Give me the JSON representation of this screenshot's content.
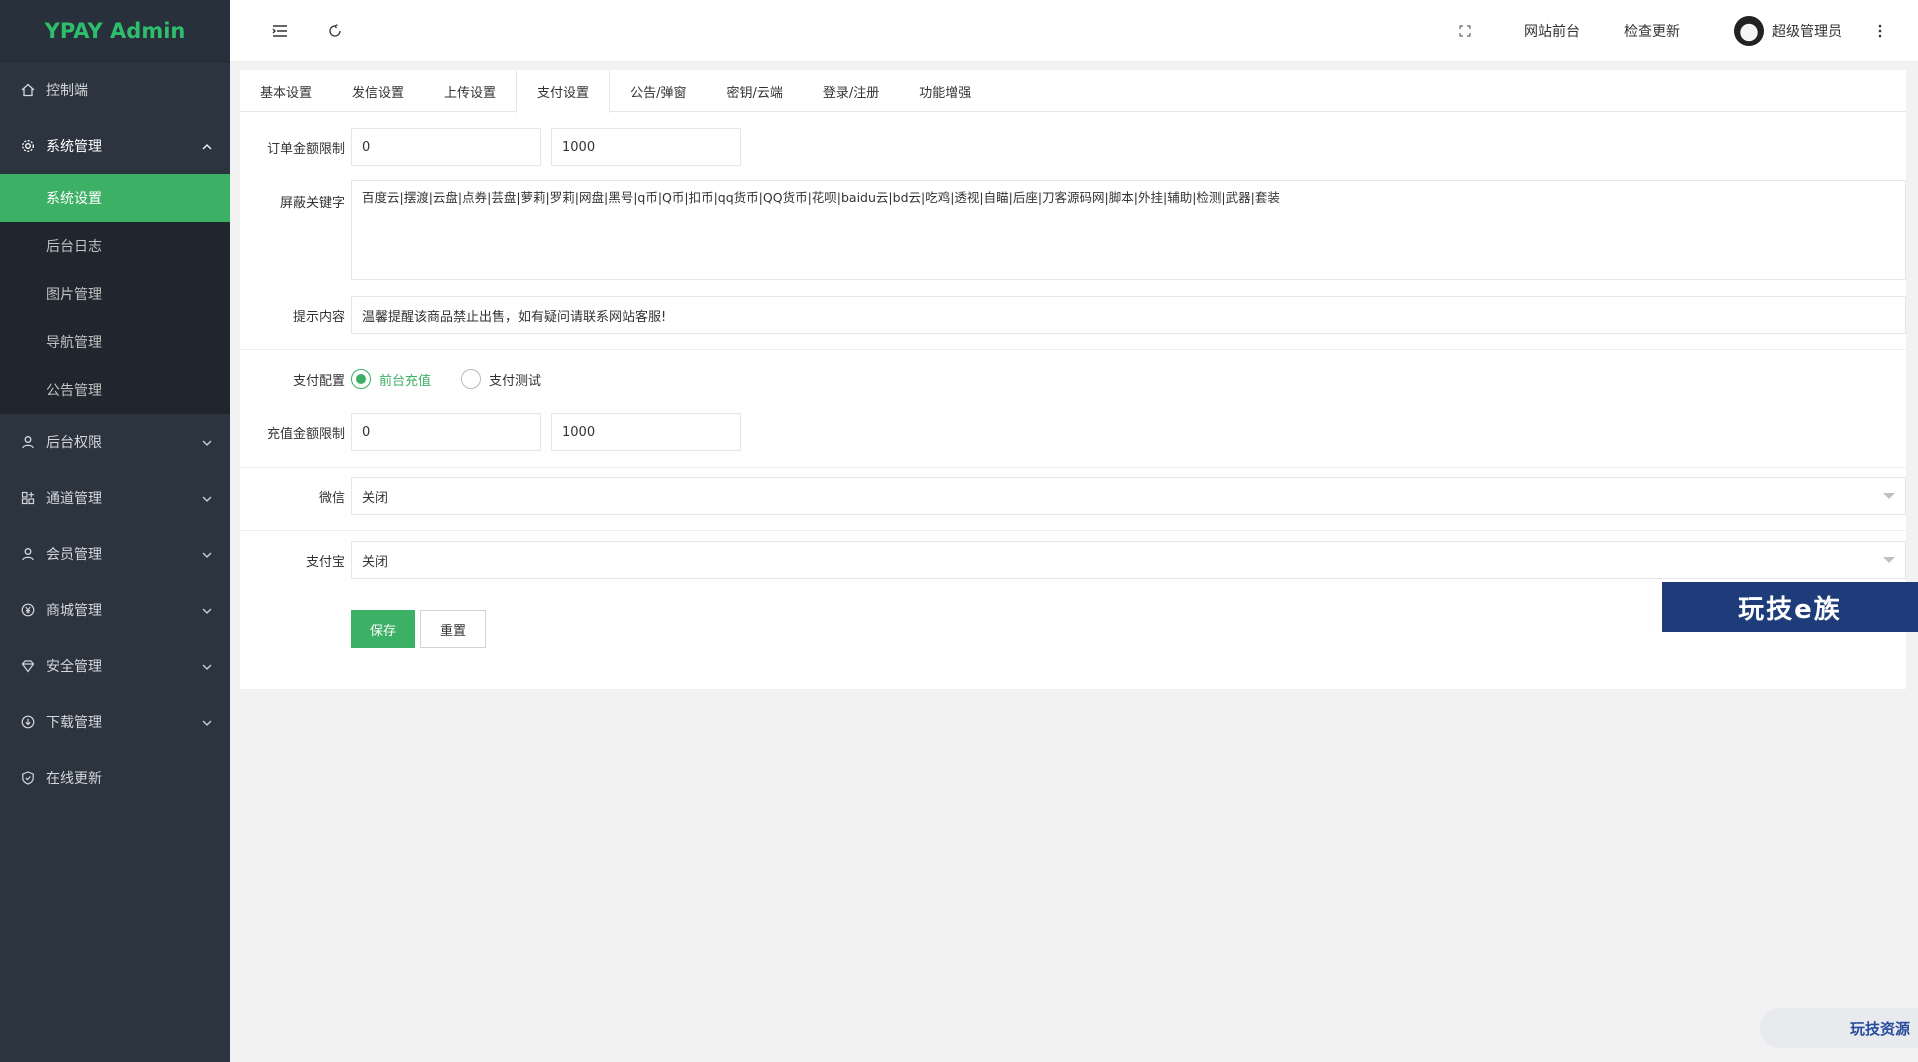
{
  "sidebar": {
    "logo": "YPAY Admin",
    "dashboard": "控制端",
    "system_group": "系统管理",
    "system_sub": [
      "系统设置",
      "后台日志",
      "图片管理",
      "导航管理",
      "公告管理"
    ],
    "groups": [
      "后台权限",
      "通道管理",
      "会员管理",
      "商城管理",
      "安全管理",
      "下载管理"
    ],
    "online_update": "在线更新"
  },
  "header": {
    "site_front": "网站前台",
    "check_update": "检查更新",
    "user_name": "超级管理员"
  },
  "tabs": [
    "基本设置",
    "发信设置",
    "上传设置",
    "支付设置",
    "公告/弹窗",
    "密钥/云端",
    "登录/注册",
    "功能增强"
  ],
  "active_tab_index": 3,
  "form": {
    "order_limit_label": "订单金额限制",
    "order_min": "0",
    "order_max": "1000",
    "keywords_label": "屏蔽关键字",
    "keywords_value": "百度云|摆渡|云盘|点券|芸盘|萝莉|罗莉|网盘|黑号|q币|Q币|扣币|qq货币|QQ货币|花呗|baidu云|bd云|吃鸡|透视|自瞄|后座|刀客源码网|脚本|外挂|辅助|检测|武器|套装",
    "tip_label": "提示内容",
    "tip_value": "温馨提醒该商品禁止出售，如有疑问请联系网站客服!",
    "pay_config_label": "支付配置",
    "pay_option_1": "前台充值",
    "pay_option_2": "支付测试",
    "recharge_limit_label": "充值金额限制",
    "recharge_min": "0",
    "recharge_max": "1000",
    "wechat_label": "微信",
    "wechat_value": "关闭",
    "alipay_label": "支付宝",
    "alipay_value": "关闭",
    "save": "保存",
    "reset": "重置"
  },
  "watermark": {
    "banner": "玩技e族",
    "badge": "玩技资源"
  },
  "colors": {
    "accent": "#3cb064",
    "sidebar_bg": "#2b343f",
    "logo_text": "#2ebd6a"
  }
}
